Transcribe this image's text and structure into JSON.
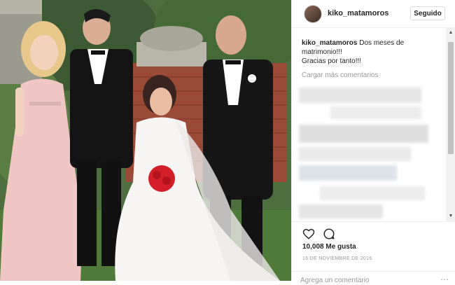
{
  "post": {
    "username": "kiko_matamoros",
    "follow_label": "Seguido",
    "caption_user": "kiko_matamoros",
    "caption_lines": [
      "Dos meses de",
      "matrimonio!!!",
      "Gracias por tanto!!!"
    ],
    "load_more": "Cargar más comentarios",
    "likes": "10,008 Me gusta",
    "date": "16 DE NOVIEMBRE DE 2016",
    "comment_placeholder": "Agrega un comentario"
  },
  "icons": {
    "like": "heart-icon",
    "comment": "speech-bubble-icon",
    "more": "ellipsis-icon",
    "scroll_up": "triangle-up",
    "scroll_down": "triangle-down"
  },
  "colors": {
    "text": "#262626",
    "muted": "#999999",
    "border": "#dbdbdb",
    "dress_pink": "#f2c9c8",
    "bouquet_red": "#d41f2b"
  }
}
